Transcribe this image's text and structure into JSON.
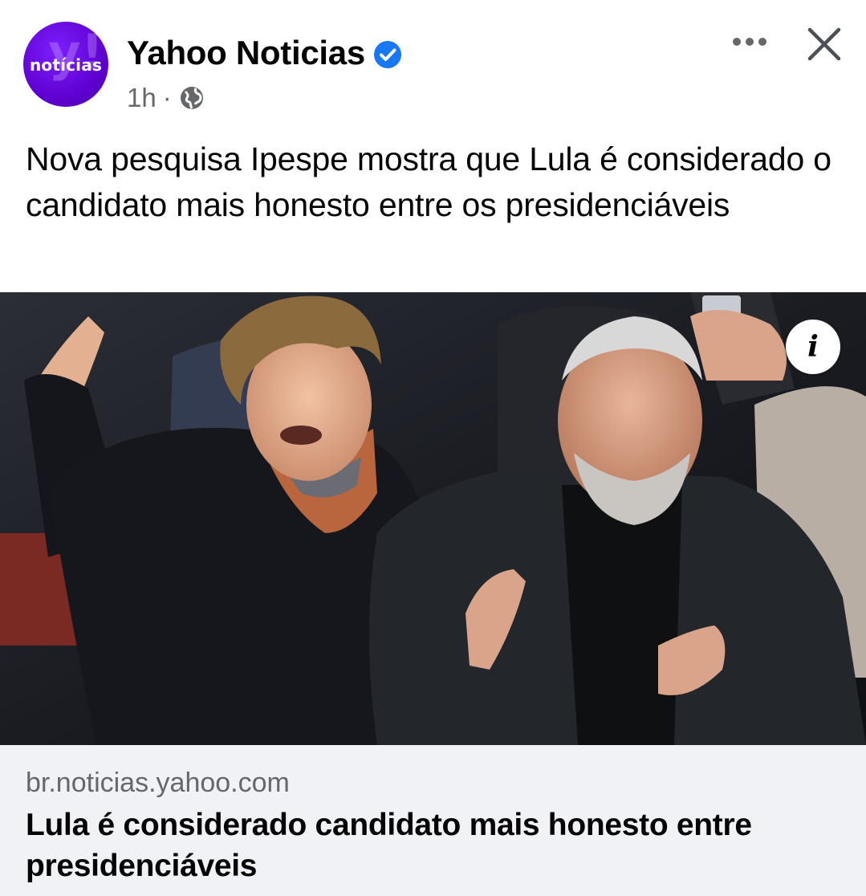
{
  "post": {
    "page_name": "Yahoo Noticias",
    "avatar_label": "notícias",
    "time": "1h",
    "separator": "·",
    "visibility_icon": "globe-icon",
    "verified_icon": "verified-badge-icon",
    "text": "Nova pesquisa Ipespe mostra que Lula é considerado o candidato mais honesto entre os presidenciáveis"
  },
  "actions": {
    "more_icon": "more-horizontal-icon",
    "close_icon": "close-icon"
  },
  "media": {
    "info_label": "i"
  },
  "link": {
    "domain": "br.noticias.yahoo.com",
    "title": "Lula é considerado candidato mais honesto entre presidenciáveis"
  },
  "colors": {
    "avatar_purple": "#6001d2",
    "verified_blue": "#1877f2",
    "secondary_text": "#65676b",
    "link_background": "#f0f2f5"
  }
}
